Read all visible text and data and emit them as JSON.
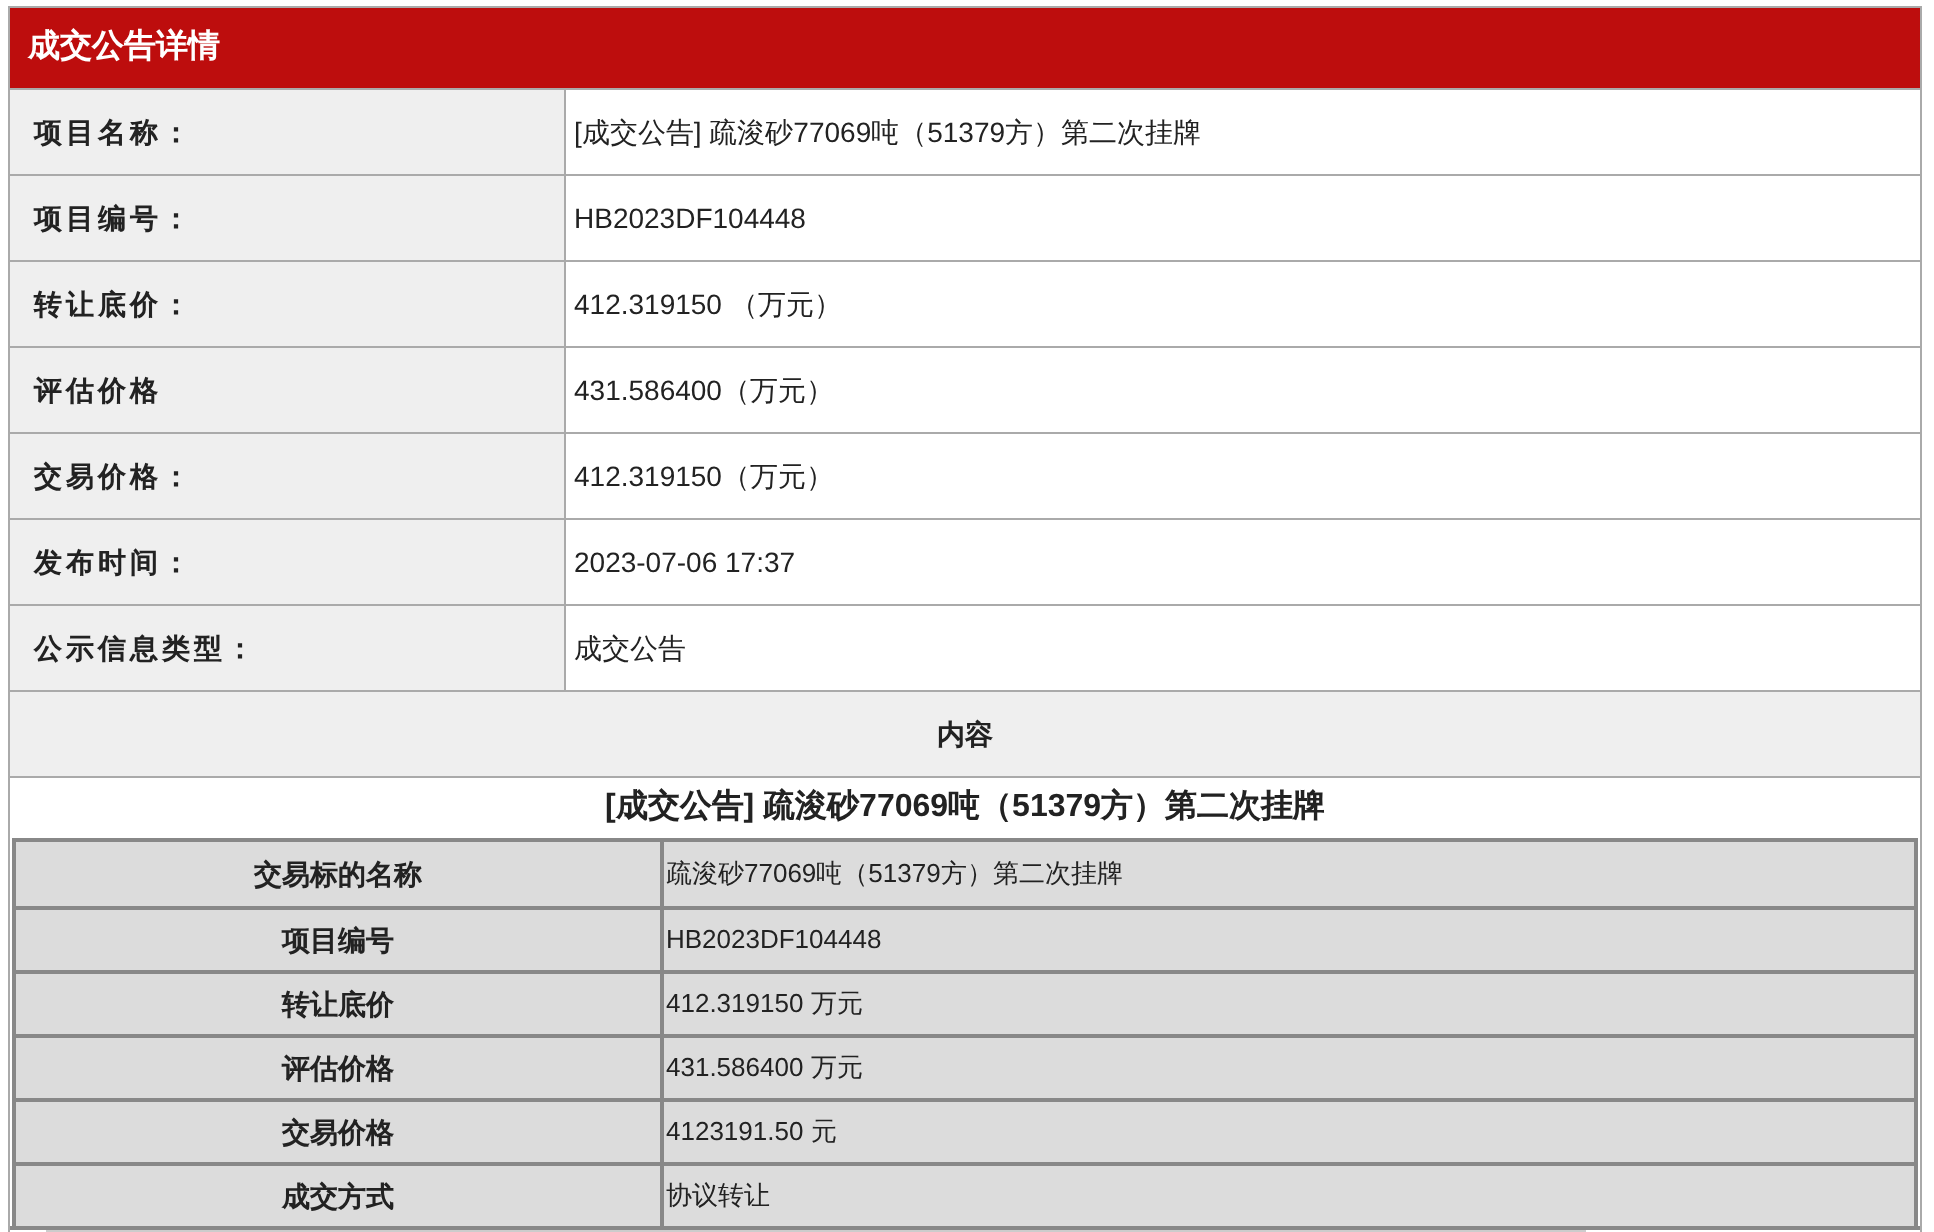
{
  "header": {
    "title": "成交公告详情"
  },
  "details": [
    {
      "label": "项目名称：",
      "value": "[成交公告] 疏浚砂77069吨（51379方）第二次挂牌"
    },
    {
      "label": "项目编号：",
      "value": "HB2023DF104448"
    },
    {
      "label": "转让底价：",
      "value": "412.319150 （万元）"
    },
    {
      "label": "评估价格",
      "value": "431.586400（万元）"
    },
    {
      "label": "交易价格：",
      "value": "412.319150（万元）"
    },
    {
      "label": "发布时间：",
      "value": "2023-07-06 17:37"
    },
    {
      "label": "公示信息类型：",
      "value": "成交公告"
    }
  ],
  "content": {
    "heading": "内容",
    "title": "[成交公告] 疏浚砂77069吨（51379方）第二次挂牌",
    "rows": [
      {
        "label": "交易标的名称",
        "value": "疏浚砂77069吨（51379方）第二次挂牌"
      },
      {
        "label": "项目编号",
        "value": "HB2023DF104448"
      },
      {
        "label": "转让底价",
        "value": "412.319150 万元"
      },
      {
        "label": "评估价格",
        "value": "431.586400 万元"
      },
      {
        "label": "交易价格",
        "value": "4123191.50 元"
      },
      {
        "label": "成交方式",
        "value": "协议转让"
      }
    ]
  }
}
